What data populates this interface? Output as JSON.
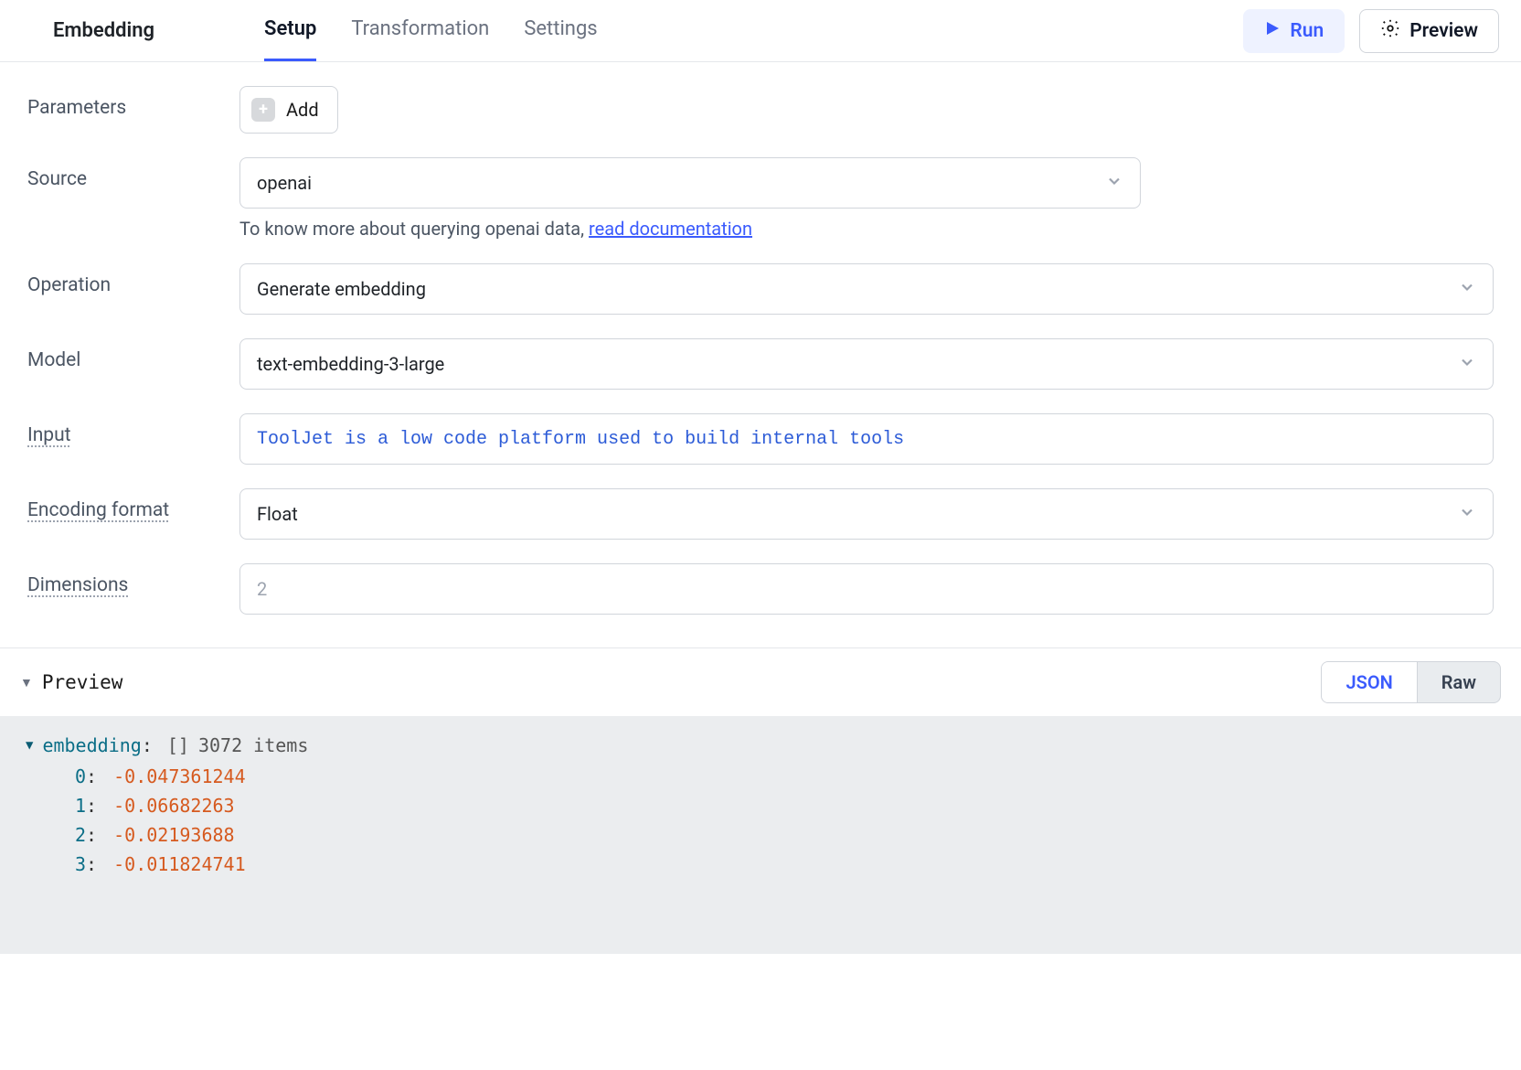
{
  "header": {
    "title": "Embedding",
    "tabs": [
      "Setup",
      "Transformation",
      "Settings"
    ],
    "active_tab_index": 0,
    "run_label": "Run",
    "preview_label": "Preview"
  },
  "form": {
    "parameters_label": "Parameters",
    "add_label": "Add",
    "source_label": "Source",
    "source_value": "openai",
    "source_helper_prefix": "To know more about querying openai data, ",
    "source_helper_link": "read documentation",
    "operation_label": "Operation",
    "operation_value": "Generate embedding",
    "model_label": "Model",
    "model_value": "text-embedding-3-large",
    "input_label": "Input",
    "input_value": "ToolJet is a low code platform used to build internal tools",
    "encoding_label": "Encoding format",
    "encoding_value": "Float",
    "dimensions_label": "Dimensions",
    "dimensions_placeholder": "2"
  },
  "preview": {
    "section_label": "Preview",
    "view_options": [
      "JSON",
      "Raw"
    ],
    "active_view_index": 0,
    "root_key": "embedding",
    "root_type": "[]",
    "item_count_label": "3072 items",
    "items": [
      {
        "index": "0",
        "value": "-0.047361244"
      },
      {
        "index": "1",
        "value": "-0.06682263"
      },
      {
        "index": "2",
        "value": "-0.02193688"
      },
      {
        "index": "3",
        "value": "-0.011824741"
      }
    ]
  }
}
